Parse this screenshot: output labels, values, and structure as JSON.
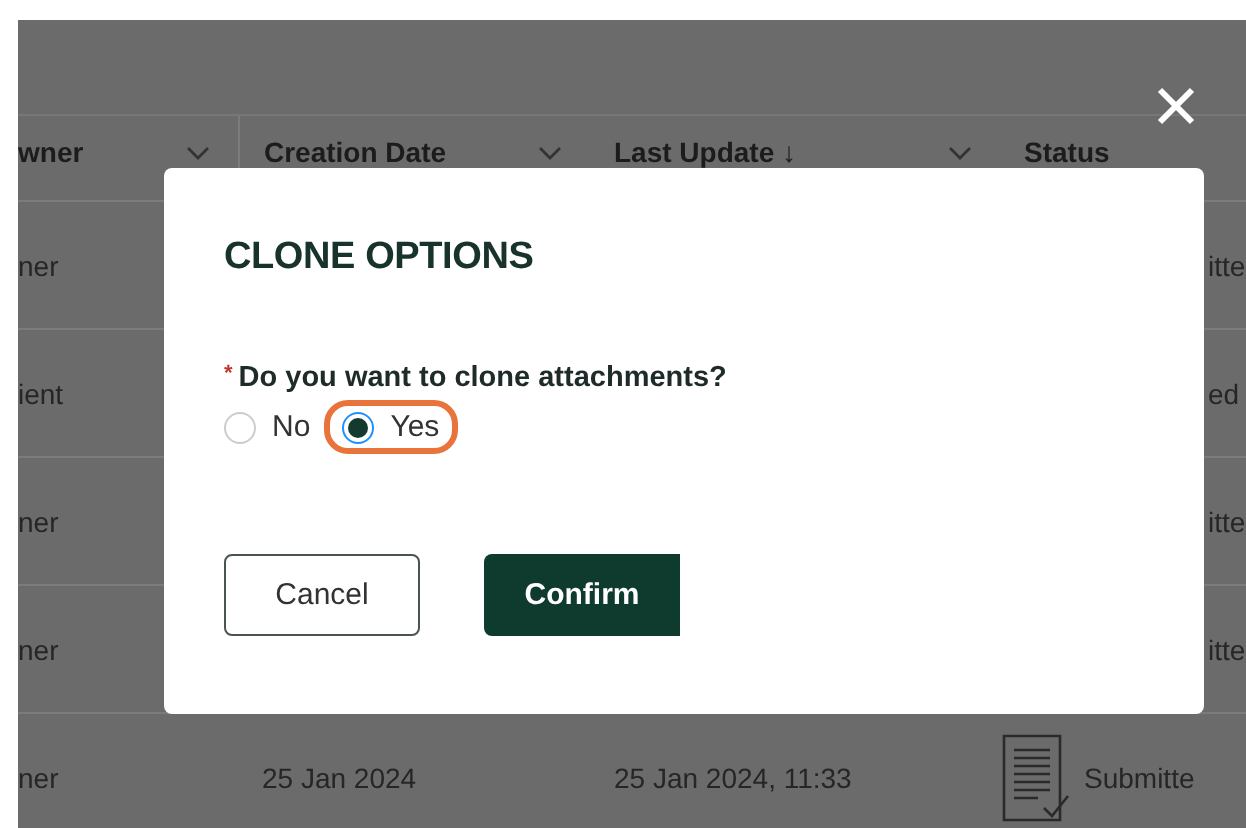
{
  "table": {
    "columns": [
      {
        "label": "wner",
        "menu": true
      },
      {
        "label": "Creation Date",
        "menu": true
      },
      {
        "label": "Last Update ↓",
        "menu": true
      },
      {
        "label": "Status",
        "menu": false
      }
    ],
    "rows": [
      {
        "owner": "ner",
        "status": "itte",
        "document_icon": false
      },
      {
        "owner": "ient",
        "status": "ed",
        "document_icon": false
      },
      {
        "owner": "ner",
        "status": "itte",
        "document_icon": false
      },
      {
        "owner": "ner",
        "status": "itte",
        "document_icon": false
      },
      {
        "owner": "ner",
        "creation_date": "25 Jan 2024",
        "last_update": "25 Jan 2024, 11:33",
        "status": "Submitte",
        "document_icon": true
      }
    ]
  },
  "dialog": {
    "title": "CLONE OPTIONS",
    "question": "Do you want to clone attachments?",
    "required_mark": "*",
    "options": [
      {
        "label": "No",
        "selected": false
      },
      {
        "label": "Yes",
        "selected": true
      }
    ],
    "buttons": [
      {
        "label": "Cancel",
        "kind": "secondary"
      },
      {
        "label": "Confirm",
        "kind": "primary"
      }
    ]
  }
}
